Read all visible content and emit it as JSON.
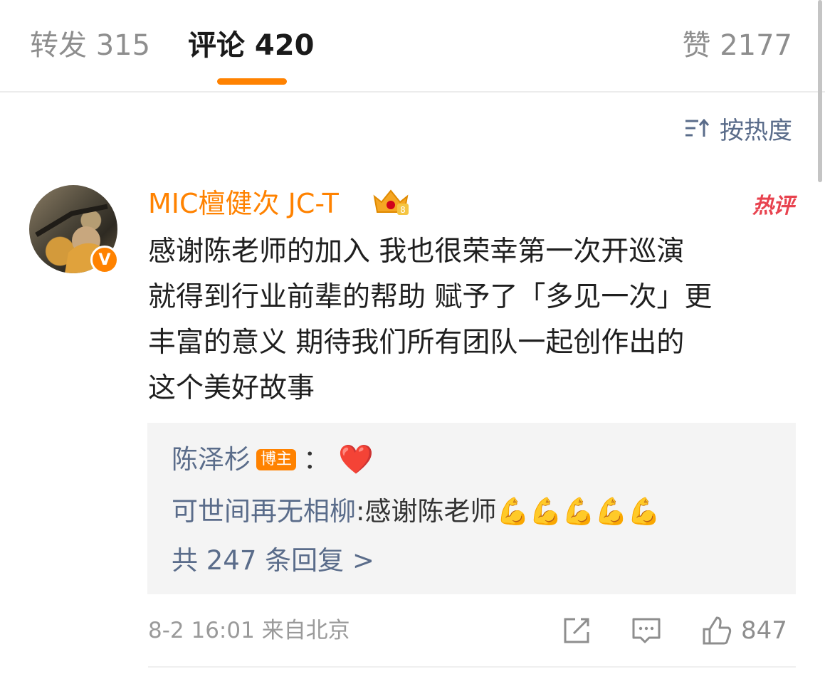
{
  "tabs": {
    "repost": "转发 315",
    "comment": "评论 420",
    "like": "赞 2177"
  },
  "sort": {
    "label": "按热度",
    "icon": "sort-icon"
  },
  "comment": {
    "username": "MIC檀健次 JC-T",
    "badge_icon": "crown-icon",
    "verified": "V",
    "hot_label": "热评",
    "text_lines": [
      "感谢陈老师的加入 我也很荣幸第一次开巡演",
      "就得到行业前辈的帮助 赋予了「多见一次」更",
      "丰富的意义 期待我们所有团队一起创作出的",
      "这个美好故事"
    ],
    "replies": [
      {
        "name": "陈泽杉",
        "tag": "博主",
        "sep": "：",
        "text": "❤️"
      },
      {
        "name": "可世间再无相柳",
        "sep": ": ",
        "text": "感谢陈老师💪💪💪💪💪"
      }
    ],
    "more_replies": "共 247 条回复 >",
    "timestamp": "8-2 16:01",
    "location": "来自北京",
    "like_count": "847"
  },
  "colors": {
    "accent": "#ff8200",
    "link": "#5a6c8a",
    "hot": "#e8434f"
  }
}
